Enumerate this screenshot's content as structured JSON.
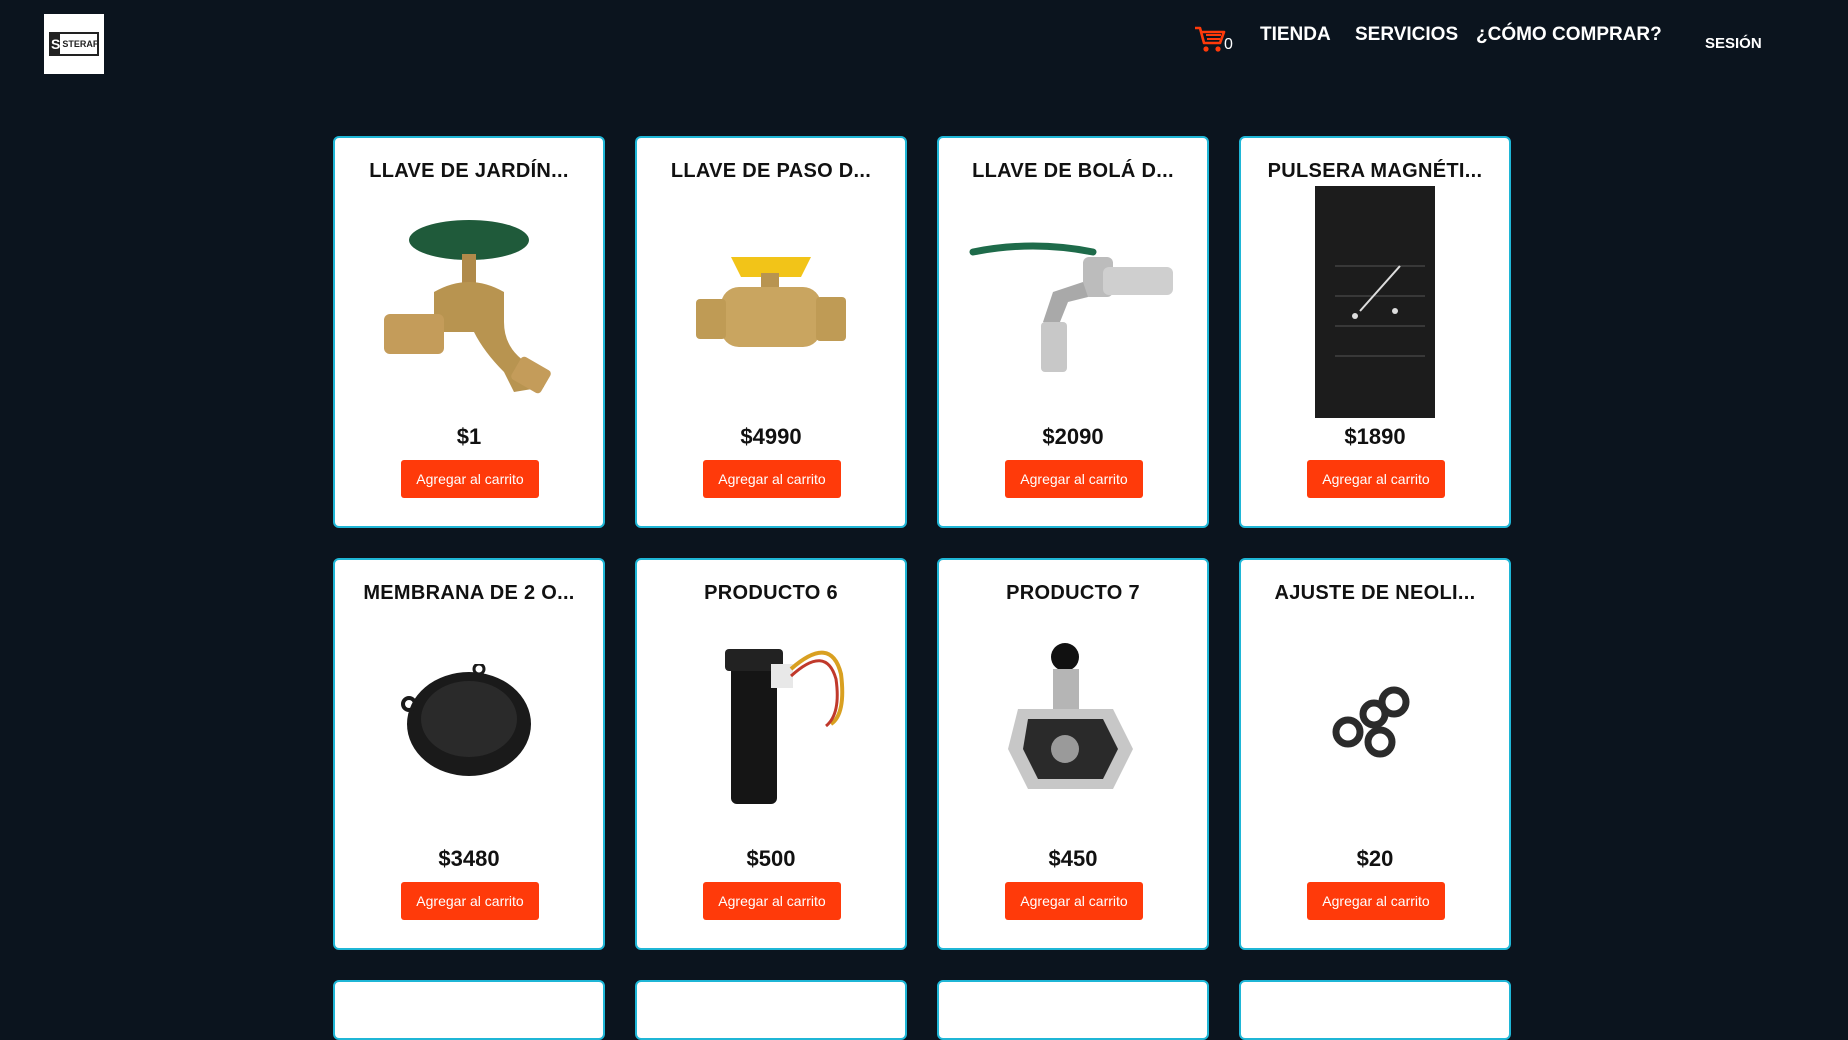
{
  "header": {
    "logo_text": "STERAF",
    "logo_letter": "S",
    "cart_count": "0",
    "nav": {
      "tienda": "TIENDA",
      "servicios": "SERVICIOS",
      "como_comprar": "¿CÓMO COMPRAR?",
      "sesion": "SESIÓN"
    },
    "accent_color": "#ff3a0a",
    "card_border_color": "#1fb6d6"
  },
  "products": [
    {
      "name": "LLAVE DE JARDÍN...",
      "price": "$1",
      "button": "Agregar al carrito",
      "image_icon": "garden-faucet-image"
    },
    {
      "name": "LLAVE DE PASO D...",
      "price": "$4990",
      "button": "Agregar al carrito",
      "image_icon": "ball-valve-yellow-image"
    },
    {
      "name": "LLAVE DE BOLÁ D...",
      "price": "$2090",
      "button": "Agregar al carrito",
      "image_icon": "lever-tap-image"
    },
    {
      "name": "PULSERA MAGNÉTI...",
      "price": "$1890",
      "button": "Agregar al carrito",
      "image_icon": "magnetic-wristband-image"
    },
    {
      "name": "MEMBRANA DE 2 O...",
      "price": "$3480",
      "button": "Agregar al carrito",
      "image_icon": "rubber-membrane-image"
    },
    {
      "name": "PRODUCTO 6",
      "price": "$500",
      "button": "Agregar al carrito",
      "image_icon": "flow-sensor-image"
    },
    {
      "name": "PRODUCTO 7",
      "price": "$450",
      "button": "Agregar al carrito",
      "image_icon": "gas-valve-image"
    },
    {
      "name": "AJUSTE DE NEOLI...",
      "price": "$20",
      "button": "Agregar al carrito",
      "image_icon": "neoprene-washers-image"
    }
  ]
}
